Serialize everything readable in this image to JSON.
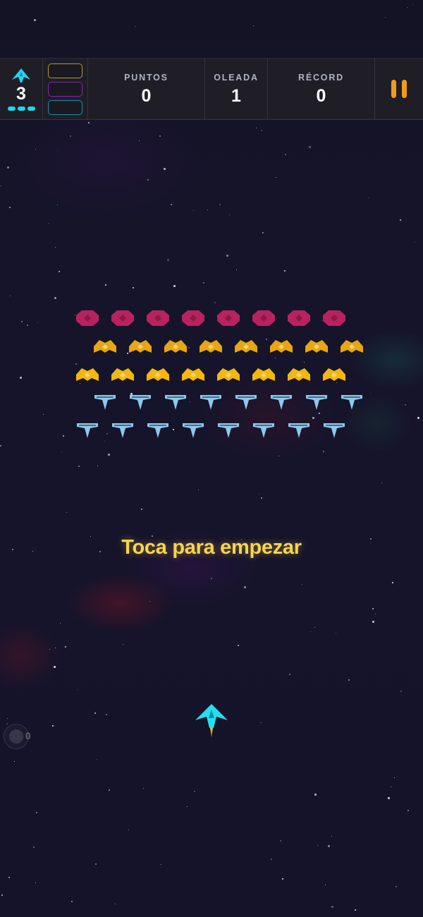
{
  "hud": {
    "lives": {
      "count": "3",
      "icon": "ship-icon",
      "pips": 3,
      "color": "#1fd6f2"
    },
    "powerup_slots": [
      {
        "name": "powerup-slot-yellow",
        "color": "#b8962a"
      },
      {
        "name": "powerup-slot-purple",
        "color": "#8a25b0"
      },
      {
        "name": "powerup-slot-cyan",
        "color": "#1f8fa6"
      }
    ],
    "score": {
      "label": "PUNTOS",
      "value": "0"
    },
    "wave": {
      "label": "OLEADA",
      "value": "1"
    },
    "record": {
      "label": "RÉCORD",
      "value": "0"
    },
    "pause": {
      "icon": "pause-icon",
      "color": "#f49b16"
    }
  },
  "formation": {
    "rows": [
      {
        "type": "crimson-pod",
        "color": "#b8225e",
        "count": 8
      },
      {
        "type": "gold-bat",
        "color": "#e8a614",
        "count": 8
      },
      {
        "type": "gold-bat",
        "color": "#f2b80f",
        "count": 8
      },
      {
        "type": "blue-drone",
        "color": "#8fc8ea",
        "count": 8
      },
      {
        "type": "blue-drone",
        "color": "#8fc8ea",
        "count": 8
      }
    ]
  },
  "prompt": {
    "text": "Toca para empezar",
    "color": "#f7d54a"
  },
  "player": {
    "icon": "player-ship-icon",
    "color": "#22e0f0"
  },
  "bomb": {
    "icon": "bomb-icon",
    "count": "0"
  }
}
